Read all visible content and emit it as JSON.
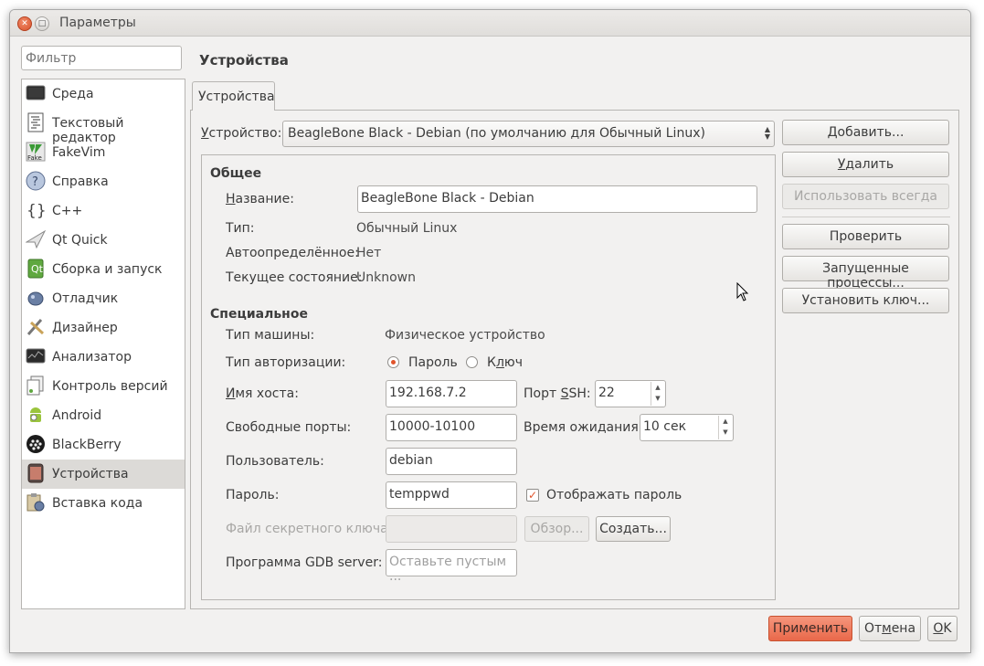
{
  "window": {
    "title": "Параметры"
  },
  "filter": {
    "placeholder": "Фильтр"
  },
  "categories": [
    {
      "label": "Среда",
      "icon": "monitor-icon"
    },
    {
      "label": "Текстовый редактор",
      "icon": "text-editor-icon"
    },
    {
      "label": "FakeVim",
      "icon": "fakevim-icon"
    },
    {
      "label": "Справка",
      "icon": "help-icon"
    },
    {
      "label": "C++",
      "icon": "cpp-braces-icon"
    },
    {
      "label": "Qt Quick",
      "icon": "paper-plane-icon"
    },
    {
      "label": "Сборка и запуск",
      "icon": "build-run-icon"
    },
    {
      "label": "Отладчик",
      "icon": "debugger-bug-icon"
    },
    {
      "label": "Дизайнер",
      "icon": "designer-brush-icon"
    },
    {
      "label": "Анализатор",
      "icon": "analyzer-icon"
    },
    {
      "label": "Контроль версий",
      "icon": "version-control-icon"
    },
    {
      "label": "Android",
      "icon": "android-icon"
    },
    {
      "label": "BlackBerry",
      "icon": "blackberry-icon"
    },
    {
      "label": "Устройства",
      "icon": "device-icon",
      "selected": true
    },
    {
      "label": "Вставка кода",
      "icon": "code-paste-icon"
    }
  ],
  "page_title": "Устройства",
  "tab": "Устройства",
  "device": {
    "label": "Устройство:",
    "label_rest": "стройство:",
    "label_accel": "У",
    "value": "BeagleBone Black - Debian (по умолчанию для Обычный Linux)"
  },
  "buttons": {
    "add": "Добавить...",
    "add_accel": "Д",
    "add_rest": "обавить...",
    "remove": "Удалить",
    "remove_accel": "У",
    "remove_rest": "далить",
    "set_default": "Использовать всегда",
    "test": "Проверить",
    "processes": "Запущенные процессы...",
    "deploy_key": "Установить ключ..."
  },
  "general": {
    "title": "Общее",
    "name_label_accel": "Н",
    "name_label_rest": "азвание:",
    "name_value": "BeagleBone Black - Debian",
    "type_label": "Тип:",
    "type_value": "Обычный Linux",
    "auto_label": "Автоопределённое:",
    "auto_value": "Нет",
    "state_label": "Текущее состояние:",
    "state_value": "Unknown"
  },
  "specific": {
    "title": "Специальное",
    "machine_type_label": "Тип машины:",
    "machine_type_value": "Физическое устройство",
    "auth_label": "Тип авторизации:",
    "auth_password": "Пароль",
    "auth_key_accel": "л",
    "auth_key_pre": "К",
    "auth_key_post": "юч",
    "auth_selected": "password",
    "host_label_accel": "И",
    "host_label_rest": "мя хоста:",
    "host_value": "192.168.7.2",
    "ssh_port_label_pre": "Порт ",
    "ssh_port_label_accel": "S",
    "ssh_port_label_post": "SH:",
    "ssh_port_value": "22",
    "free_ports_label": "Свободные порты:",
    "free_ports_value": "10000-10100",
    "timeout_label": "Время ожидания:",
    "timeout_value": "10 сек",
    "user_label": "Пользователь:",
    "user_value": "debian",
    "password_label": "Пароль:",
    "password_value": "temppwd",
    "show_password_label": "Отображать пароль",
    "show_password_checked": true,
    "key_file_label": "Файл секретного ключа:",
    "key_file_value": "",
    "browse": "Обзор...",
    "create": "Создать...",
    "gdb_label": "Программа GDB server:",
    "gdb_placeholder": "Оставьте пустым ..."
  },
  "footer": {
    "apply": "Применить",
    "cancel_pre": "От",
    "cancel_accel": "м",
    "cancel_post": "ена",
    "ok_pre": "",
    "ok_accel": "O",
    "ok_post": "K"
  },
  "colors": {
    "accent": "#e9684a",
    "selection": "#dcdad7"
  }
}
